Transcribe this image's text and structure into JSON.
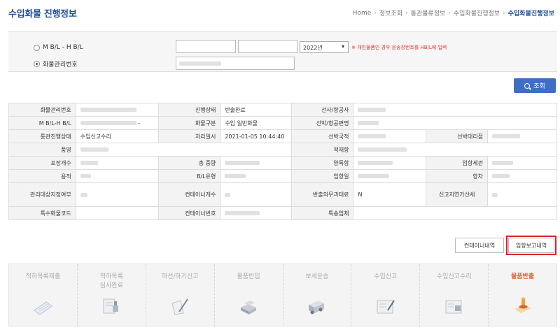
{
  "header": {
    "title": "수입화물 진행정보",
    "breadcrumb": [
      "Home",
      "정보조회",
      "통관물류정보",
      "수입화물진행정보",
      "수입화물진행정보"
    ]
  },
  "search": {
    "radio_bl": "M B/L - H B/L",
    "radio_cargo": "화물관리번호",
    "year": "2022년",
    "notice": "※ 개인물품인 경우 운송장번호를 HB/L에 입력",
    "button": "조회"
  },
  "info": {
    "r1": [
      "화물관리번호",
      "진행상태",
      "반출완료",
      "선사/항공사"
    ],
    "r2": [
      "M B/L-H B/L",
      "-",
      "화물구분",
      "수입 일반화물",
      "선박/항공편명"
    ],
    "r3": [
      "통관진행상태",
      "수입신고수리",
      "처리일시",
      "2021-01-05 10:44:40",
      "선박국적",
      "선박대리점"
    ],
    "r4": [
      "품명",
      "적재항"
    ],
    "r5": [
      "포장개수",
      "총 중량",
      "양륙항",
      "입항세관"
    ],
    "r6": [
      "용적",
      "B/L유형",
      "입항일",
      "항차"
    ],
    "r7": [
      "관리대상지정여부",
      "컨테이너개수",
      "반출의무과태료",
      "N",
      "신고지연가산세"
    ],
    "r8": [
      "특수화물코드",
      "컨테이너번호",
      "특송업체"
    ]
  },
  "buttons": {
    "container": "컨테이너내역",
    "report": "입항보고내역"
  },
  "steps": [
    {
      "label": "적하목록제출"
    },
    {
      "label": "적하목록\n심사완료"
    },
    {
      "label": "하선/하기신고"
    },
    {
      "label": "물품반입"
    },
    {
      "label": "보세운송"
    },
    {
      "label": "수입신고"
    },
    {
      "label": "수입신고수리"
    },
    {
      "label": "물품반출"
    }
  ],
  "colors": {
    "accent": "#1f4e96",
    "button": "#3f6fc4",
    "active_step": "#e05a2a",
    "highlight": "#d8242b"
  }
}
